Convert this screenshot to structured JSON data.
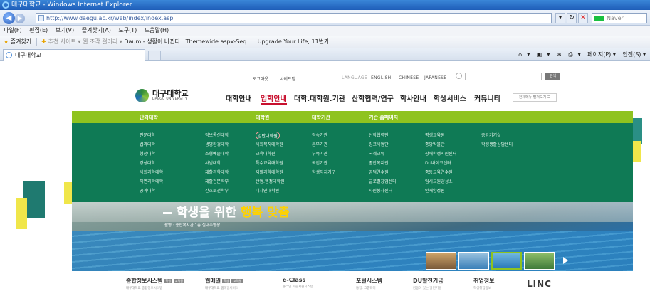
{
  "browser": {
    "title": "대구대학교 - Windows Internet Explorer",
    "address": "http://www.daegu.ac.kr/web/index/index.asp",
    "search_placeholder": "Naver",
    "menus": [
      "파일(F)",
      "편집(E)",
      "보기(V)",
      "즐겨찾기(A)",
      "도구(T)",
      "도움말(H)"
    ],
    "favorites": {
      "label": "즐겨찾기",
      "suggested": "추천 사이트 ▾",
      "webslice": "웹 조각 갤러리 ▾",
      "links": [
        "Daum - 생활이 바뀐다",
        "Themewide.aspx-Seq...",
        "Upgrade Your Life, 11번가"
      ]
    },
    "tab_title": "대구대학교",
    "commands": [
      "▾",
      "▾",
      "▾",
      "페이지(P) ▾",
      "안전(S) ▾"
    ]
  },
  "site": {
    "util_links": [
      "로그아웃",
      "사이트맵"
    ],
    "languages": [
      "LANGUAGE",
      "ENGLISH",
      "CHINESE",
      "JAPANESE"
    ],
    "search_button": "검색",
    "logo_kr": "대구대학교",
    "logo_en": "DAEGU UNIVERSITY",
    "gnb": [
      "대학안내",
      "입학안내",
      "대학.대학원.기관",
      "산학협력/연구",
      "학사안내",
      "학생서비스",
      "커뮤니티"
    ],
    "gnb_active_index": 1,
    "all_menu": "전체메뉴 펼쳐보기 ☰",
    "mega_headers": [
      "단과대학",
      "대학원",
      "대학기관",
      "기관 홈페이지"
    ],
    "mega_columns": [
      [
        "인문대학",
        "법과대학",
        "행정대학",
        "경상대학",
        "사회과학대학",
        "자연과학대학",
        "공과대학"
      ],
      [
        "정보통신대학",
        "생명환경대학",
        "조형예술대학",
        "사범대학",
        "재활과학대학",
        "재활전문학부",
        "간호보건학부"
      ],
      [
        "일반대학원",
        "사회복지대학원",
        "교육대학원",
        "특수교육대학원",
        "재활과학대학원",
        "산업.행정대학원",
        "디자인대학원"
      ],
      [
        "직속기관",
        "본부기관",
        "부속기관",
        "독립기관",
        "학생자치기구"
      ],
      [
        "산학협력단",
        "링크사업단",
        "국제교류",
        "종합복지관",
        "영덕연수원",
        "글로컬창업센터",
        "자원봉사센터"
      ],
      [
        "평생교육원",
        "중앙박물관",
        "장애학생지원센터",
        "DU바이크센터",
        "중등교육연수원",
        "임시교원양성소",
        "인재양성원"
      ],
      [
        "중앙기기실",
        "학생생활상담센터"
      ]
    ],
    "hero": {
      "title_plain": "학생을 위한 ",
      "title_em": "행복 맞춤",
      "caption": "촬영 : 종합복지관 1층 실내수영장"
    },
    "quick_links": [
      {
        "title": "종합정보시스템",
        "sub": "대구대학교 종합정보시스템",
        "badges": [
          "학생",
          "교직원"
        ]
      },
      {
        "title": "웹메일",
        "sub": "대구대학교 웹메일서비스",
        "badges": [
          "학생",
          "교직원"
        ]
      },
      {
        "title": "e-Class",
        "sub": "온라인 학습지원시스템",
        "badges": []
      },
      {
        "title": "포털시스템",
        "sub": "통합, 그룹웨어",
        "badges": []
      },
      {
        "title": "DU발전기금",
        "sub": "감동이 있는 발전기금",
        "badges": []
      },
      {
        "title": "취업정보",
        "sub": "학생취업정보",
        "badges": []
      }
    ],
    "linc": "LINC",
    "colors": {
      "primary_green": "#0f7a55",
      "lime": "#8fc31f",
      "active_red": "#c8102e"
    }
  }
}
